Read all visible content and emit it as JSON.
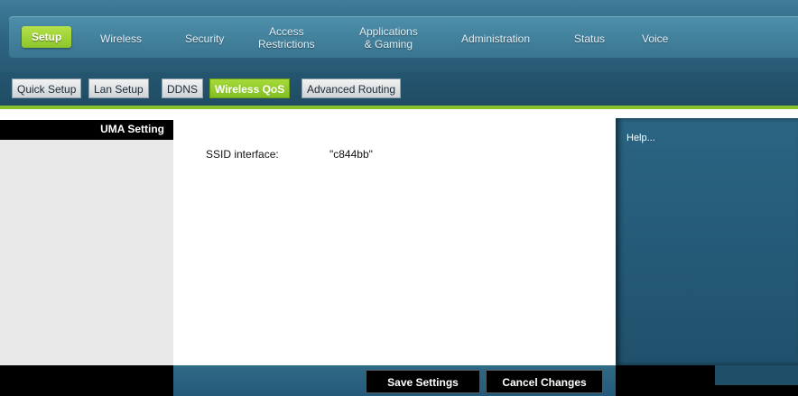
{
  "main_nav": {
    "items": [
      {
        "label": "Setup",
        "active": true
      },
      {
        "label": "Wireless",
        "active": false
      },
      {
        "label": "Security",
        "active": false
      },
      {
        "label": "Access\nRestrictions",
        "active": false
      },
      {
        "label": "Applications\n& Gaming",
        "active": false
      },
      {
        "label": "Administration",
        "active": false
      },
      {
        "label": "Status",
        "active": false
      },
      {
        "label": "Voice",
        "active": false
      }
    ]
  },
  "sub_nav": {
    "items": [
      {
        "label": "Quick Setup",
        "active": false
      },
      {
        "label": "Lan Setup",
        "active": false
      },
      {
        "label": "DDNS",
        "active": false
      },
      {
        "label": "Wireless QoS",
        "active": true
      },
      {
        "label": "Advanced Routing",
        "active": false
      }
    ]
  },
  "sidebar": {
    "section_title": "UMA Setting"
  },
  "content": {
    "ssid_label": "SSID interface:",
    "ssid_value": "\"c844bb\""
  },
  "help": {
    "link_label": "Help..."
  },
  "actions": {
    "save_label": "Save Settings",
    "cancel_label": "Cancel Changes"
  },
  "colors": {
    "accent_green": "#8cc62a",
    "nav_blue": "#2e6480"
  }
}
